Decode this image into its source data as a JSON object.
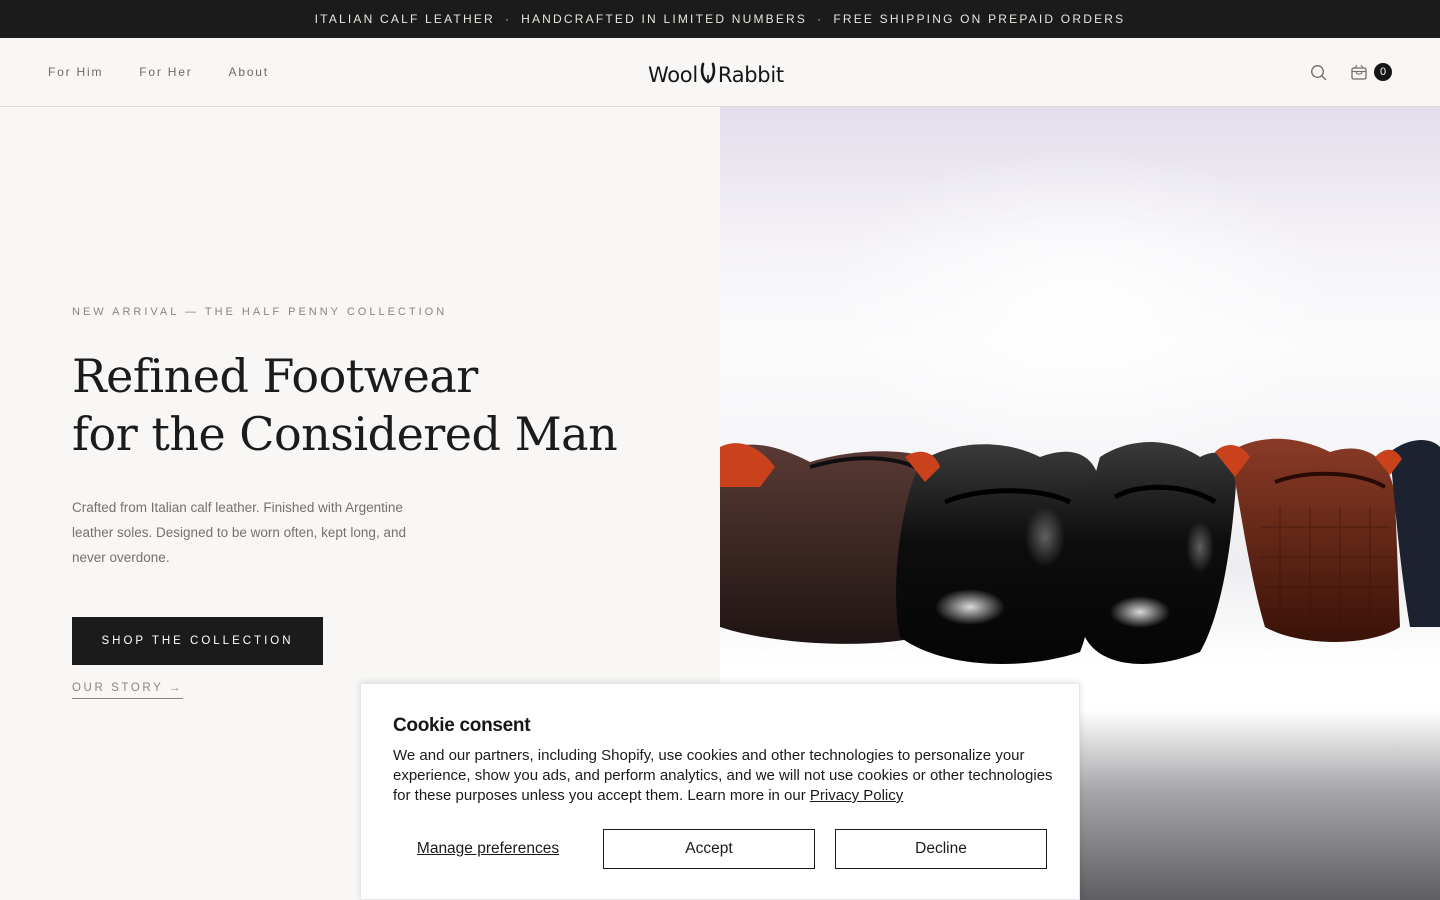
{
  "announcement": {
    "items": [
      "ITALIAN CALF LEATHER",
      "HANDCRAFTED IN LIMITED NUMBERS",
      "FREE SHIPPING ON PREPAID ORDERS"
    ],
    "separator": "·"
  },
  "header": {
    "nav": [
      {
        "label": "For Him"
      },
      {
        "label": "For Her"
      },
      {
        "label": "About"
      }
    ],
    "logo": {
      "left": "Wool",
      "right": "Rabbit"
    },
    "cart_count": "0",
    "icons": {
      "search": "search-icon",
      "cart": "cart-icon"
    }
  },
  "hero": {
    "eyebrow": "NEW ARRIVAL — THE HALF PENNY COLLECTION",
    "headline_line1": "Refined Footwear",
    "headline_line2": "for the Considered Man",
    "description": "Crafted from Italian calf leather. Finished with Argentine leather soles. Designed to be worn often, kept long, and never overdone.",
    "cta_label": "SHOP THE COLLECTION",
    "story_label": "OUR STORY →"
  },
  "cookie": {
    "title": "Cookie consent",
    "body": "We and our partners, including Shopify, use cookies and other technologies to personalize your experience, show you ads, and perform analytics, and we will not use cookies or other technologies for these purposes unless you accept them. Learn more in our ",
    "link_label": "Privacy Policy",
    "manage_label": "Manage preferences",
    "accept_label": "Accept",
    "decline_label": "Decline"
  },
  "colors": {
    "announcement_bg": "#1b1b1b",
    "page_bg": "#f8f7f5",
    "cta_bg": "#1b1b1b"
  }
}
